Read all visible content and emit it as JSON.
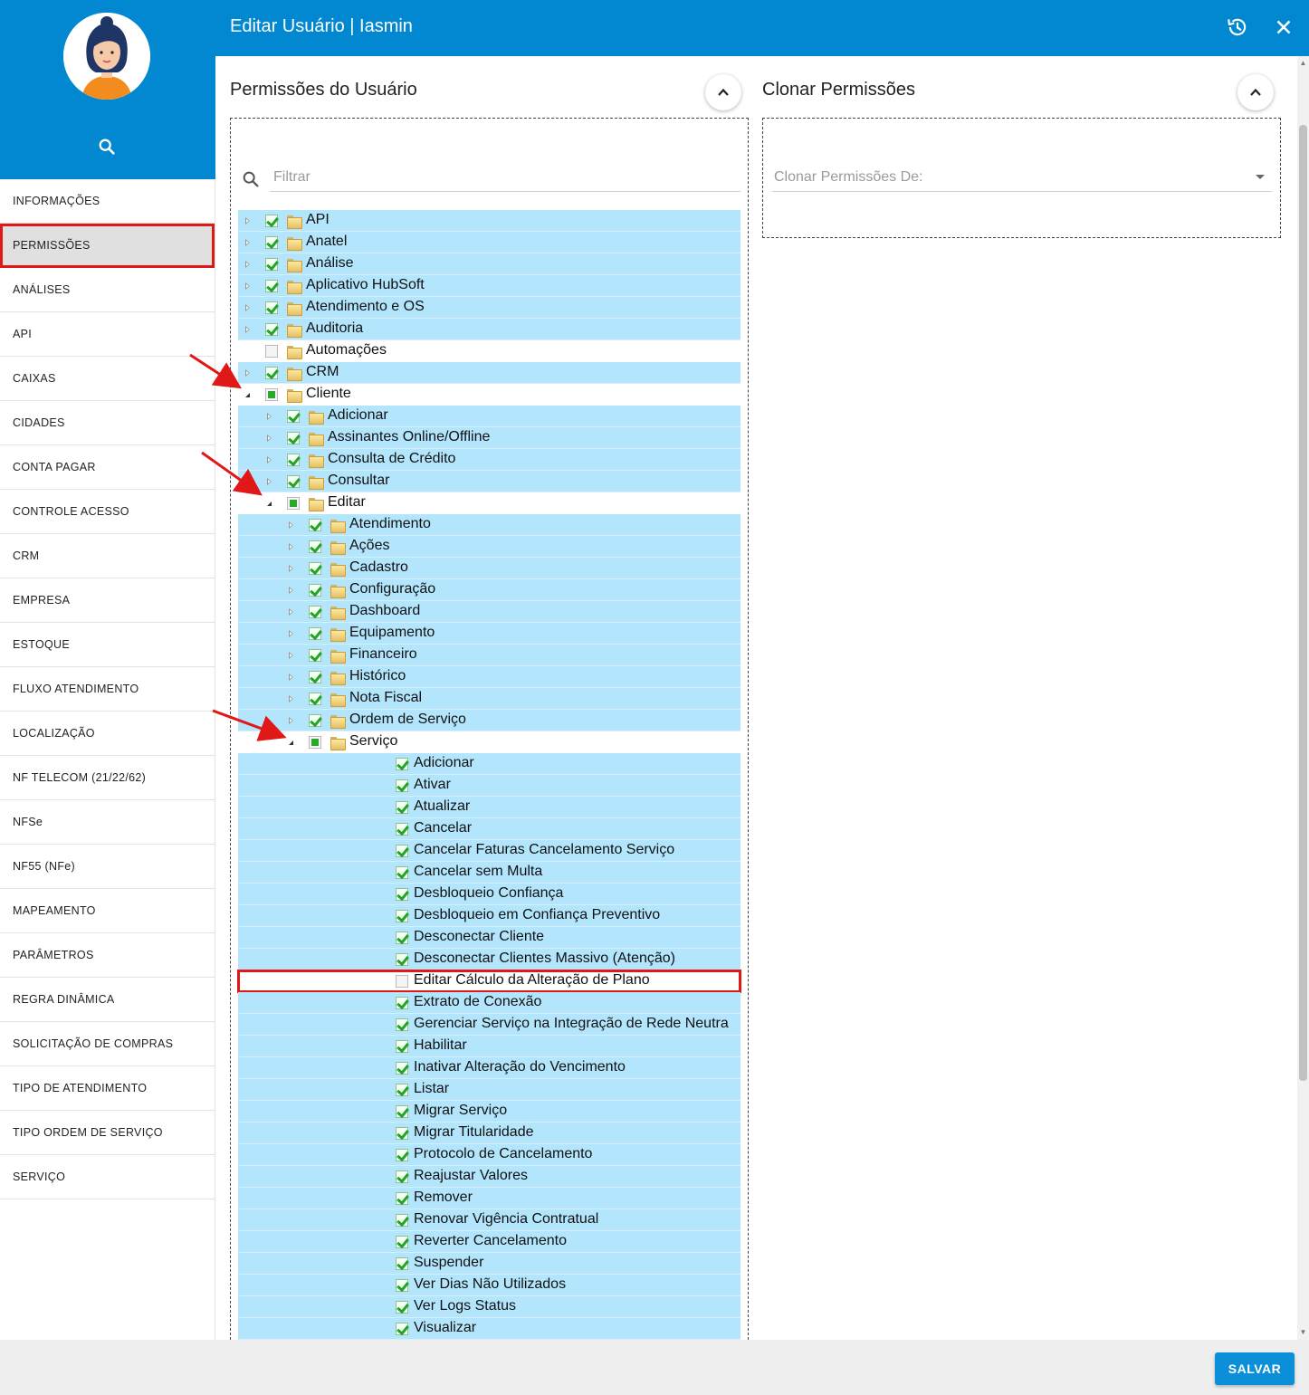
{
  "header": {
    "title": "Editar Usuário | Iasmin",
    "history_icon": "history-icon",
    "close_icon": "close-icon"
  },
  "sidebar": {
    "avatar": "user-avatar",
    "search_icon": "search-icon",
    "items": [
      {
        "label": "INFORMAÇÕES",
        "active": false
      },
      {
        "label": "PERMISSÕES",
        "active": true
      },
      {
        "label": "ANÁLISES",
        "active": false
      },
      {
        "label": "API",
        "active": false
      },
      {
        "label": "CAIXAS",
        "active": false
      },
      {
        "label": "CIDADES",
        "active": false
      },
      {
        "label": "CONTA PAGAR",
        "active": false
      },
      {
        "label": "CONTROLE ACESSO",
        "active": false
      },
      {
        "label": "CRM",
        "active": false
      },
      {
        "label": "EMPRESA",
        "active": false
      },
      {
        "label": "ESTOQUE",
        "active": false
      },
      {
        "label": "FLUXO ATENDIMENTO",
        "active": false
      },
      {
        "label": "LOCALIZAÇÃO",
        "active": false
      },
      {
        "label": "NF TELECOM (21/22/62)",
        "active": false
      },
      {
        "label": "NFSe",
        "active": false
      },
      {
        "label": "NF55 (NFe)",
        "active": false
      },
      {
        "label": "MAPEAMENTO",
        "active": false
      },
      {
        "label": "PARÂMETROS",
        "active": false
      },
      {
        "label": "REGRA DINÂMICA",
        "active": false
      },
      {
        "label": "SOLICITAÇÃO DE COMPRAS",
        "active": false
      },
      {
        "label": "TIPO DE ATENDIMENTO",
        "active": false
      },
      {
        "label": "TIPO ORDEM DE SERVIÇO",
        "active": false
      },
      {
        "label": "SERVIÇO",
        "active": false
      }
    ]
  },
  "permissions": {
    "title": "Permissões do Usuário",
    "filter_placeholder": "Filtrar",
    "tree": [
      {
        "label": "API",
        "level": 0,
        "expander": "closed",
        "check": "checked",
        "folder": true,
        "selected": true
      },
      {
        "label": "Anatel",
        "level": 0,
        "expander": "closed",
        "check": "checked",
        "folder": true,
        "selected": true
      },
      {
        "label": "Análise",
        "level": 0,
        "expander": "closed",
        "check": "checked",
        "folder": true,
        "selected": true
      },
      {
        "label": "Aplicativo HubSoft",
        "level": 0,
        "expander": "closed",
        "check": "checked",
        "folder": true,
        "selected": true
      },
      {
        "label": "Atendimento e OS",
        "level": 0,
        "expander": "closed",
        "check": "checked",
        "folder": true,
        "selected": true
      },
      {
        "label": "Auditoria",
        "level": 0,
        "expander": "closed",
        "check": "checked",
        "folder": true,
        "selected": true
      },
      {
        "label": "Automações",
        "level": 0,
        "expander": "none",
        "check": "unchecked",
        "folder": true,
        "selected": false
      },
      {
        "label": "CRM",
        "level": 0,
        "expander": "closed",
        "check": "checked",
        "folder": true,
        "selected": true
      },
      {
        "label": "Cliente",
        "level": 0,
        "expander": "open",
        "check": "partial",
        "folder": true,
        "selected": false
      },
      {
        "label": "Adicionar",
        "level": 1,
        "expander": "closed",
        "check": "checked",
        "folder": true,
        "selected": true
      },
      {
        "label": "Assinantes Online/Offline",
        "level": 1,
        "expander": "closed",
        "check": "checked",
        "folder": true,
        "selected": true
      },
      {
        "label": "Consulta de Crédito",
        "level": 1,
        "expander": "closed",
        "check": "checked",
        "folder": true,
        "selected": true
      },
      {
        "label": "Consultar",
        "level": 1,
        "expander": "closed",
        "check": "checked",
        "folder": true,
        "selected": true
      },
      {
        "label": "Editar",
        "level": 1,
        "expander": "open",
        "check": "partial",
        "folder": true,
        "selected": false
      },
      {
        "label": "Atendimento",
        "level": 2,
        "expander": "closed",
        "check": "checked",
        "folder": true,
        "selected": true
      },
      {
        "label": "Ações",
        "level": 2,
        "expander": "closed",
        "check": "checked",
        "folder": true,
        "selected": true
      },
      {
        "label": "Cadastro",
        "level": 2,
        "expander": "closed",
        "check": "checked",
        "folder": true,
        "selected": true
      },
      {
        "label": "Configuração",
        "level": 2,
        "expander": "closed",
        "check": "checked",
        "folder": true,
        "selected": true
      },
      {
        "label": "Dashboard",
        "level": 2,
        "expander": "closed",
        "check": "checked",
        "folder": true,
        "selected": true
      },
      {
        "label": "Equipamento",
        "level": 2,
        "expander": "closed",
        "check": "checked",
        "folder": true,
        "selected": true
      },
      {
        "label": "Financeiro",
        "level": 2,
        "expander": "closed",
        "check": "checked",
        "folder": true,
        "selected": true
      },
      {
        "label": "Histórico",
        "level": 2,
        "expander": "closed",
        "check": "checked",
        "folder": true,
        "selected": true
      },
      {
        "label": "Nota Fiscal",
        "level": 2,
        "expander": "closed",
        "check": "checked",
        "folder": true,
        "selected": true
      },
      {
        "label": "Ordem de Serviço",
        "level": 2,
        "expander": "closed",
        "check": "checked",
        "folder": true,
        "selected": true
      },
      {
        "label": "Serviço",
        "level": 2,
        "expander": "open",
        "check": "partial",
        "folder": true,
        "selected": false
      },
      {
        "label": "Adicionar",
        "level": 3,
        "expander": "none",
        "check": "checked",
        "folder": false,
        "selected": true
      },
      {
        "label": "Ativar",
        "level": 3,
        "expander": "none",
        "check": "checked",
        "folder": false,
        "selected": true
      },
      {
        "label": "Atualizar",
        "level": 3,
        "expander": "none",
        "check": "checked",
        "folder": false,
        "selected": true
      },
      {
        "label": "Cancelar",
        "level": 3,
        "expander": "none",
        "check": "checked",
        "folder": false,
        "selected": true
      },
      {
        "label": "Cancelar Faturas Cancelamento Serviço",
        "level": 3,
        "expander": "none",
        "check": "checked",
        "folder": false,
        "selected": true
      },
      {
        "label": "Cancelar sem Multa",
        "level": 3,
        "expander": "none",
        "check": "checked",
        "folder": false,
        "selected": true
      },
      {
        "label": "Desbloqueio Confiança",
        "level": 3,
        "expander": "none",
        "check": "checked",
        "folder": false,
        "selected": true
      },
      {
        "label": "Desbloqueio em Confiança Preventivo",
        "level": 3,
        "expander": "none",
        "check": "checked",
        "folder": false,
        "selected": true
      },
      {
        "label": "Desconectar Cliente",
        "level": 3,
        "expander": "none",
        "check": "checked",
        "folder": false,
        "selected": true
      },
      {
        "label": "Desconectar Clientes Massivo (Atenção)",
        "level": 3,
        "expander": "none",
        "check": "checked",
        "folder": false,
        "selected": true
      },
      {
        "label": "Editar Cálculo da Alteração de Plano",
        "level": 3,
        "expander": "none",
        "check": "unchecked",
        "folder": false,
        "selected": false,
        "highlighted": true
      },
      {
        "label": "Extrato de Conexão",
        "level": 3,
        "expander": "none",
        "check": "checked",
        "folder": false,
        "selected": true
      },
      {
        "label": "Gerenciar Serviço na Integração de Rede Neutra",
        "level": 3,
        "expander": "none",
        "check": "checked",
        "folder": false,
        "selected": true
      },
      {
        "label": "Habilitar",
        "level": 3,
        "expander": "none",
        "check": "checked",
        "folder": false,
        "selected": true
      },
      {
        "label": "Inativar Alteração do Vencimento",
        "level": 3,
        "expander": "none",
        "check": "checked",
        "folder": false,
        "selected": true
      },
      {
        "label": "Listar",
        "level": 3,
        "expander": "none",
        "check": "checked",
        "folder": false,
        "selected": true
      },
      {
        "label": "Migrar Serviço",
        "level": 3,
        "expander": "none",
        "check": "checked",
        "folder": false,
        "selected": true
      },
      {
        "label": "Migrar Titularidade",
        "level": 3,
        "expander": "none",
        "check": "checked",
        "folder": false,
        "selected": true
      },
      {
        "label": "Protocolo de Cancelamento",
        "level": 3,
        "expander": "none",
        "check": "checked",
        "folder": false,
        "selected": true
      },
      {
        "label": "Reajustar Valores",
        "level": 3,
        "expander": "none",
        "check": "checked",
        "folder": false,
        "selected": true
      },
      {
        "label": "Remover",
        "level": 3,
        "expander": "none",
        "check": "checked",
        "folder": false,
        "selected": true
      },
      {
        "label": "Renovar Vigência Contratual",
        "level": 3,
        "expander": "none",
        "check": "checked",
        "folder": false,
        "selected": true
      },
      {
        "label": "Reverter Cancelamento",
        "level": 3,
        "expander": "none",
        "check": "checked",
        "folder": false,
        "selected": true
      },
      {
        "label": "Suspender",
        "level": 3,
        "expander": "none",
        "check": "checked",
        "folder": false,
        "selected": true
      },
      {
        "label": "Ver Dias Não Utilizados",
        "level": 3,
        "expander": "none",
        "check": "checked",
        "folder": false,
        "selected": true
      },
      {
        "label": "Ver Logs Status",
        "level": 3,
        "expander": "none",
        "check": "checked",
        "folder": false,
        "selected": true
      },
      {
        "label": "Visualizar",
        "level": 3,
        "expander": "none",
        "check": "checked",
        "folder": false,
        "selected": true
      }
    ]
  },
  "clone": {
    "title": "Clonar Permissões",
    "select_placeholder": "Clonar Permissões De:"
  },
  "footer": {
    "save_label": "SALVAR"
  },
  "colors": {
    "primary": "#0288d1",
    "row_selected": "#b3e5fc",
    "annotation_red": "#e01818",
    "save_button": "#0a8fd8"
  }
}
